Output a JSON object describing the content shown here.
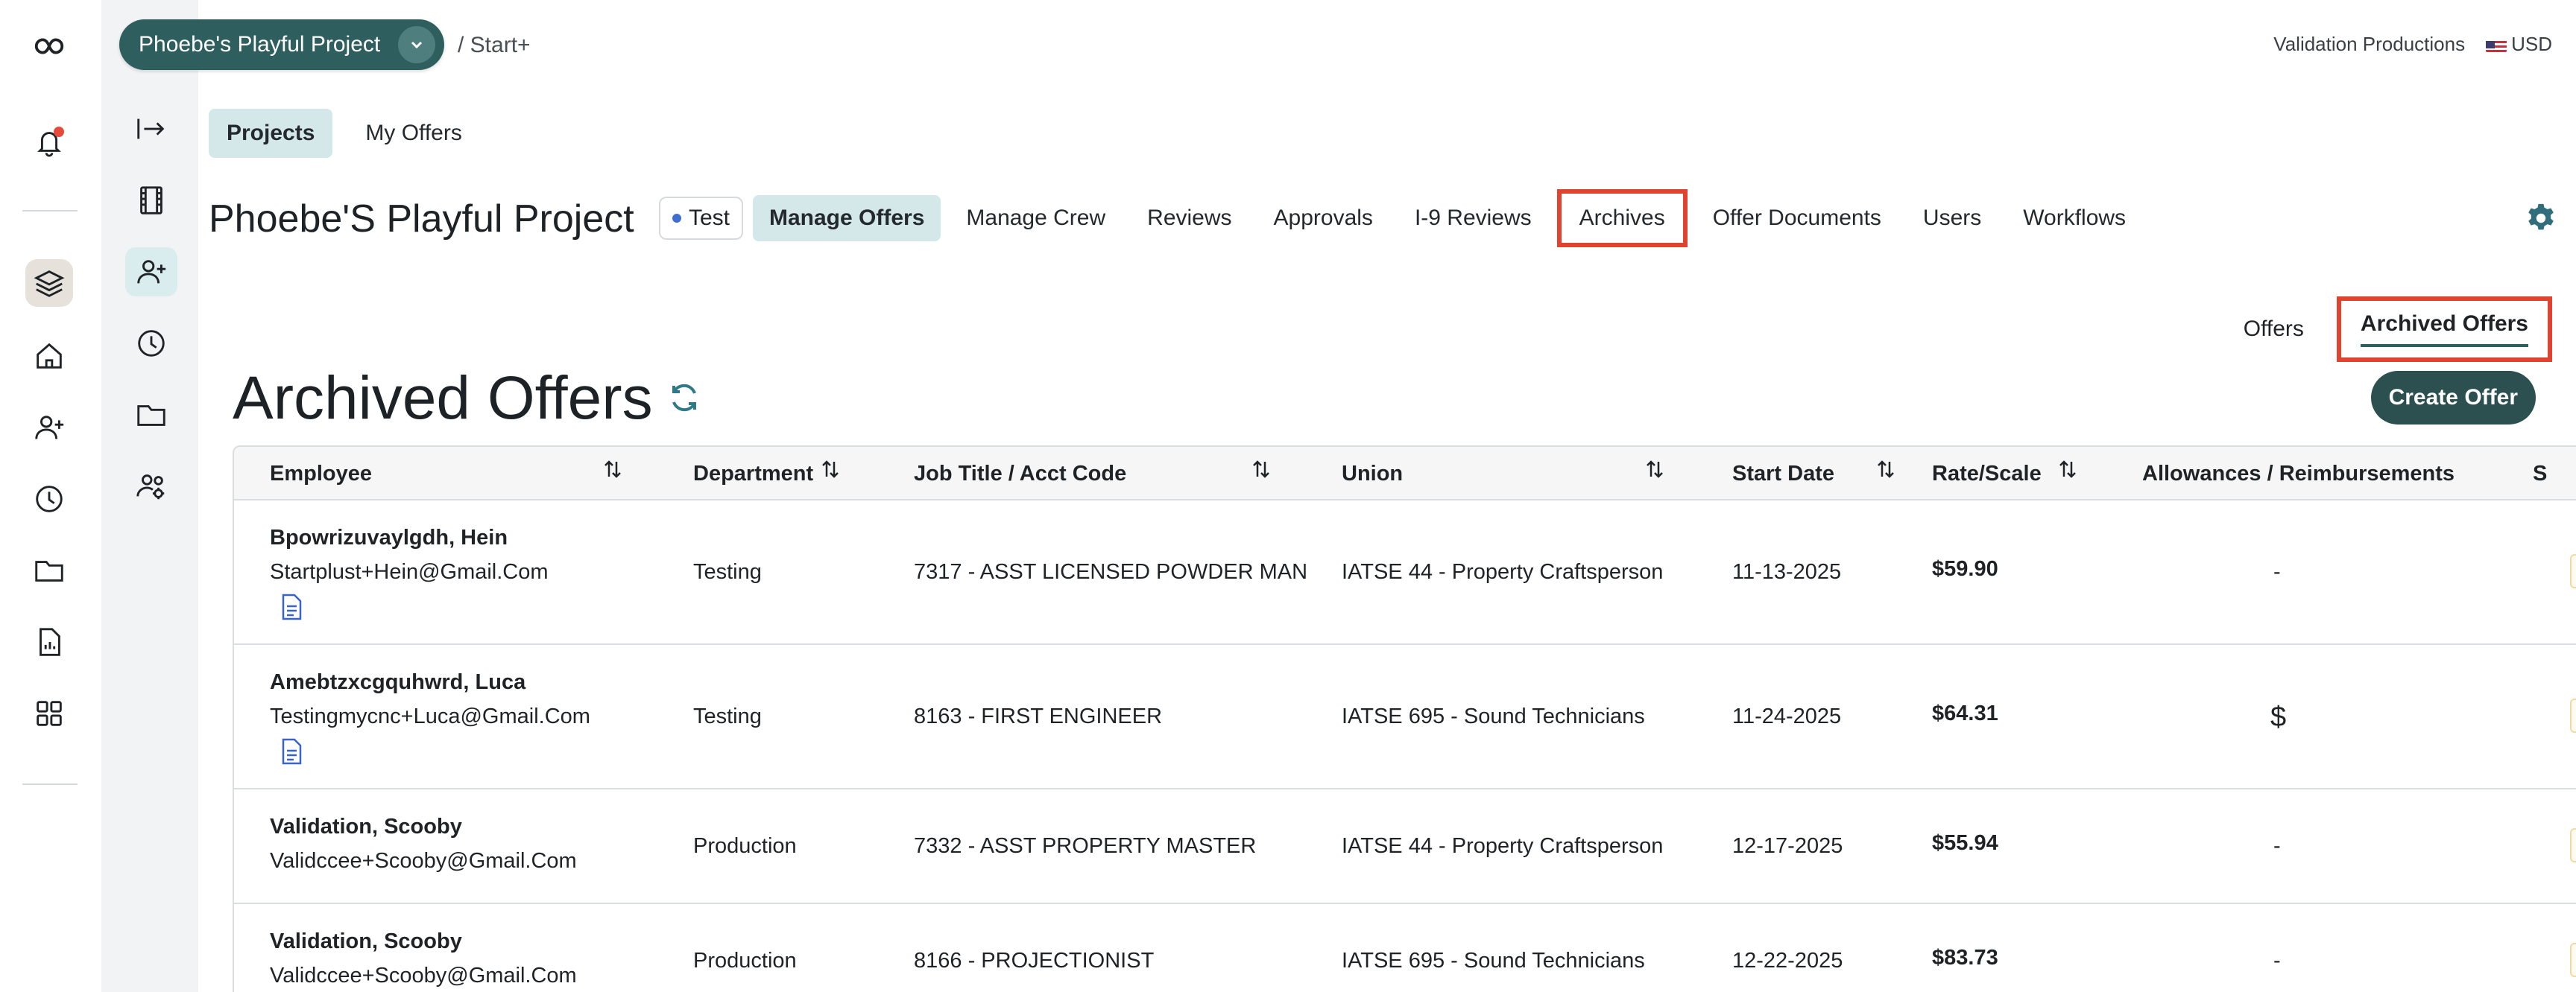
{
  "header": {
    "project_name": "Phoebe's Playful Project",
    "breadcrumb": "/ Start+",
    "company": "Validation Productions",
    "currency": "USD"
  },
  "subtabs": [
    "Projects",
    "My Offers"
  ],
  "project": {
    "title": "Phoebe'S Playful Project",
    "badge": "Test",
    "nav": [
      "Manage Offers",
      "Manage Crew",
      "Reviews",
      "Approvals",
      "I-9 Reviews",
      "Archives",
      "Offer Documents",
      "Users",
      "Workflows"
    ],
    "active_nav": "Manage Offers",
    "highlighted_nav": "Archives"
  },
  "offers_toggle": {
    "offers": "Offers",
    "archived": "Archived Offers"
  },
  "section": {
    "title": "Archived Offers",
    "create_button": "Create Offer"
  },
  "table": {
    "columns": [
      "Employee",
      "Department",
      "Job Title / Acct Code",
      "Union",
      "Start Date",
      "Rate/Scale",
      "Allowances / Reimbursements",
      "S"
    ],
    "rows": [
      {
        "name": "Bpowrizuvaylgdh, Hein",
        "email": "Startplust+Hein@Gmail.Com",
        "department": "Testing",
        "job": "7317 - ASST LICENSED POWDER MAN",
        "union": "IATSE 44 - Property Craftsperson",
        "start": "11-13-2025",
        "rate": "$59.90",
        "allowance": "-"
      },
      {
        "name": "Amebtzxcgquhwrd, Luca",
        "email": "Testingmycnc+Luca@Gmail.Com",
        "department": "Testing",
        "job": "8163 - FIRST ENGINEER",
        "union": "IATSE 695 - Sound Technicians",
        "start": "11-24-2025",
        "rate": "$64.31",
        "allowance": "$"
      },
      {
        "name": "Validation, Scooby",
        "email": "Validccee+Scooby@Gmail.Com",
        "department": "Production",
        "job": "7332 - ASST PROPERTY MASTER",
        "union": "IATSE 44 - Property Craftsperson",
        "start": "12-17-2025",
        "rate": "$55.94",
        "allowance": "-"
      },
      {
        "name": "Validation, Scooby",
        "email": "Validccee+Scooby@Gmail.Com",
        "department": "Production",
        "job": "8166 - PROJECTIONIST",
        "union": "IATSE 695 - Sound Technicians",
        "start": "12-22-2025",
        "rate": "$83.73",
        "allowance": "-"
      }
    ]
  }
}
